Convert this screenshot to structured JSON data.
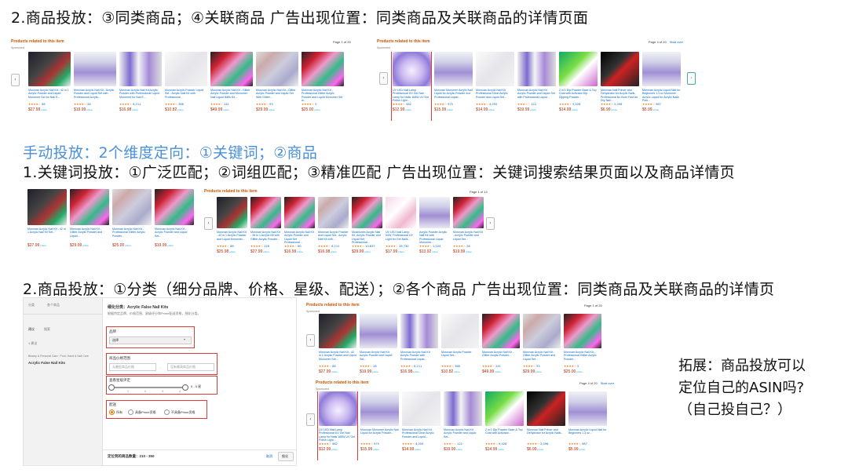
{
  "headings": {
    "h1": "2.商品投放：③同类商品；④关联商品   广告出现位置：同类商品及关联商品的详情页面",
    "h2": "手动投放：2个维度定向：①关键词；②商品",
    "h3": "1.关键词投放：①广泛匹配；②词组匹配；③精准匹配     广告出现位置：关键词搜索结果页面以及商品详情页",
    "h4": "2.商品投放：①分类（细分品牌、价格、星级、配送）；②各个商品   广告出现位置：同类商品及关联商品的详情页"
  },
  "callout": {
    "line1": "拓展：商品投放可以",
    "line2": "定位自己的ASIN吗?",
    "line3": "（自己投自己？）"
  },
  "common": {
    "carousel_title": "Products related to this item",
    "sponsored": "Sponsored",
    "page_1_of_20": "Page 1 of 20",
    "page_4_of_20": "Page 4 of 20",
    "page_1_of_14": "Page 1 of 14",
    "start_over": "Start over",
    "prev_arrow": "‹",
    "next_arrow": "›",
    "prime": "prime"
  },
  "carousel_top_left": [
    {
      "title": "Morovan Acrylic Nail Kit - 42 in 1 Acrylic Powder and Liquid Monomer Set for Nail E...",
      "stars": "★★★★☆",
      "reviews": "86",
      "price": "$27.99",
      "theme": "t-dark"
    },
    {
      "title": "Morovan Acrylic Nail Kit - Acrylic Powder and Liquid Set with Professional Acrylic...",
      "stars": "★★★★☆",
      "reviews": "28",
      "price": "$19.99",
      "theme": "t-purple"
    },
    {
      "title": "Morovan Acrylic Nail Kit Acrylic Powder with Professional Liquid Monomer for Nail E...",
      "stars": "★★★★☆",
      "reviews": "6,211",
      "price": "$16.98",
      "theme": "t-bottles"
    },
    {
      "title": "Morovan Acrylic Powder Liquid Set - Acrylic Nail Kit with Professional...",
      "stars": "★★★★☆",
      "reviews": "368",
      "price": "$10.82",
      "theme": "t-white"
    },
    {
      "title": "Morovan Acrylic Nail Kit - Glitter Acrylic Powder and Monomer Nail Liquid Nails Kit...",
      "stars": "★★★★☆",
      "reviews": "241",
      "price": "$49.99",
      "theme": "t-kit"
    },
    {
      "title": "Morovan Acrylic Nail Kit - Glitter Acrylic Powder and Liquid Set With Glitter...",
      "stars": "★★★★☆",
      "reviews": "93",
      "price": "$29.99",
      "theme": "t-glitter"
    },
    {
      "title": "Morovan Acrylic Nail Kit - Professional Glitter Acrylic Powder and Liquid Monomer Set w...",
      "stars": "★★★★☆",
      "reviews": "5",
      "price": "$25.00",
      "theme": "t-kit"
    }
  ],
  "carousel_top_right": [
    {
      "title": "UV LED Nail Lamp Professional UV Gel Nail Lamp for Nails 168W UV Gel Polish Light...",
      "stars": "★★★★☆",
      "reviews": "482",
      "price": "$12.99",
      "theme": "t-lamp",
      "boxed": true
    },
    {
      "title": "Morovan Monomer Acrylic Nail Liquid for Acrylic Powder 4oz Professional Liquid...",
      "stars": "★★★★☆",
      "reviews": "975",
      "price": "$15.99",
      "theme": "t-purple"
    },
    {
      "title": "Morovan Acrylic Nail Kit Professional Clear Acrylic Powder and Liquid Set...",
      "stars": "★★★★☆",
      "reviews": "4,055",
      "price": "$14.99",
      "theme": "t-white"
    },
    {
      "title": "Morovan Acrylic Nail Kit Acrylic Powder and Liquid Set with Professional Liquid...",
      "stars": "★★★☆☆",
      "reviews": "122",
      "price": "$19.99",
      "theme": "t-bottles"
    },
    {
      "title": "2 in 1 Dip Powder Base & Top Coat with Activator Dip Dipping Powder...",
      "stars": "★★★★☆",
      "reviews": "9,026",
      "price": "$14.99",
      "theme": "t-green"
    },
    {
      "title": "Morovan Nail Primer and Dehydrator for Acrylic Nails, Professional No Burn Fast Air Dry Nail...",
      "stars": "★★★★☆",
      "reviews": "2,096",
      "price": "$6.99",
      "theme": "t-black"
    },
    {
      "title": "Morovan Acrylic Liquid Nail for Beginners 1.3 oz Monomer Acrylic Liquid for Acrylic Nails Pow...",
      "stars": "★★★★☆",
      "reviews": "987",
      "price": "$5.99",
      "theme": "t-purple"
    }
  ],
  "search_results": [
    {
      "title": "Morovan Acrylic Nail Kit - 42 in 1 Acrylic Nail Kit Set...",
      "price": "$27.99",
      "theme": "t-dark"
    },
    {
      "title": "Morovan Acrylic Nail Kit - Glitter Acrylic Powder and Liquid...",
      "price": "$29.99",
      "theme": "t-kit"
    },
    {
      "title": "Morovan Acrylic Nail Kit - Professional Glitter Acrylic Powder...",
      "price": "$25.00",
      "theme": "t-glitter"
    },
    {
      "title": "Morovan Acrylic Nail Kit - Acrylic Powder and Liquid Set...",
      "price": "$19.99",
      "theme": "t-kit"
    }
  ],
  "carousel_mid": [
    {
      "title": "Morovan Acrylic Nail Kit - 42 in 1 Acrylic Powder and Liquid Monomer...",
      "stars": "★★★★☆",
      "reviews": "86",
      "price": "$25.98",
      "theme": "t-dark"
    },
    {
      "title": "Morovan Acrylic Nail Kit - 36 in 1 Acrylic Kit with Glitter Acrylic Powder...",
      "stars": "★★★★☆",
      "reviews": "128",
      "price": "$27.99",
      "theme": "t-kit"
    },
    {
      "title": "Morovan Acrylic Nail Kit Acrylic Powder and Liquid Set Professional...",
      "stars": "★★★★☆",
      "reviews": "60",
      "price": "$16.99",
      "theme": "t-kit"
    },
    {
      "title": "Morovan Acrylic Powder and Liquid Set - Acrylic Nail Kit with...",
      "stars": "★★★★☆",
      "reviews": "6,211",
      "price": "$16.98",
      "theme": "t-glitter"
    },
    {
      "title": "Modelones Acrylic Nail Kit, Acrylic Powder and Liquid Set, Professional...",
      "stars": "★★★★☆",
      "reviews": "10,637",
      "price": "$29.99",
      "theme": "t-kit"
    },
    {
      "title": "UV LED Nail Lamp 54W, Professional UV Light for Gel Nails...",
      "stars": "★★★★☆",
      "reviews": "26,732",
      "price": "$17.99",
      "theme": "t-tip"
    },
    {
      "title": "Acrylic Powder Acrylic Nail Kit with Professional Liquid Monomer...",
      "stars": "★★★★☆",
      "reviews": "1,024",
      "price": "$13.92",
      "theme": "t-purple"
    },
    {
      "title": "Morovan Acrylic Nail Kit - Acrylic Powder and Liquid Set...",
      "stars": "★★★★☆",
      "reviews": "28",
      "price": "$19.99",
      "theme": "t-kit"
    }
  ],
  "carousel_bot_top": [
    {
      "title": "Morovan Acrylic Nail Kit - 42 in 1 Acrylic Powder and Liquid Monomer Set...",
      "stars": "★★★★☆",
      "reviews": "86",
      "price": "$27.99",
      "theme": "t-dark"
    },
    {
      "title": "Morovan Acrylic Nail Kit Acrylic Powder and Liquid Set...",
      "stars": "★★★★☆",
      "reviews": "28",
      "price": "$19.99",
      "theme": "t-purple"
    },
    {
      "title": "Morovan Acrylic Nail Kit Acrylic Powder with Professional Liquid...",
      "stars": "★★★★☆",
      "reviews": "6,211",
      "price": "$16.98",
      "theme": "t-bottles"
    },
    {
      "title": "Morovan Acrylic Powder Liquid Set...",
      "stars": "★★★★☆",
      "reviews": "368",
      "price": "$10.82",
      "theme": "t-white"
    },
    {
      "title": "Morovan Acrylic Nail Kit - Glitter Acrylic Powder...",
      "stars": "★★★★☆",
      "reviews": "241",
      "price": "$49.99",
      "theme": "t-kit"
    },
    {
      "title": "Morovan Acrylic Nail Kit - Glitter Acrylic Powder and Liquid Set...",
      "stars": "★★★★☆",
      "reviews": "93",
      "price": "$29.99",
      "theme": "t-glitter"
    },
    {
      "title": "Morovan Acrylic Nail Kit - Professional Glitter Acrylic Powder...",
      "stars": "★★★★☆",
      "reviews": "5",
      "price": "$25.00",
      "theme": "t-kit"
    }
  ],
  "carousel_bot_bottom": [
    {
      "title": "UV LED Nail Lamp Professional UV Gel Nail Lamp for Nails 168W UV Gel Polish Light...",
      "stars": "★★★★☆",
      "reviews": "482",
      "price": "$12.99",
      "theme": "t-lamp",
      "boxed": true
    },
    {
      "title": "Morovan Monomer Acrylic Nail Liquid for Acrylic Powder...",
      "stars": "★★★★☆",
      "reviews": "975",
      "price": "$15.99",
      "theme": "t-purple"
    },
    {
      "title": "Morovan Acrylic Nail Kit Professional Clear Acrylic Powder and Liquid...",
      "stars": "★★★★☆",
      "reviews": "4,055",
      "price": "$14.99",
      "theme": "t-white"
    },
    {
      "title": "Morovan Acrylic Nail Kit Acrylic Powder and Liquid Set...",
      "stars": "★★★☆☆",
      "reviews": "122",
      "price": "$19.99",
      "theme": "t-bottles"
    },
    {
      "title": "2 in 1 Dip Powder Base & Top Coat with Activator...",
      "stars": "★★★★☆",
      "reviews": "9,026",
      "price": "$14.99",
      "theme": "t-green"
    },
    {
      "title": "Morovan Nail Primer and Dehydrator for Acrylic Nails...",
      "stars": "★★★★☆",
      "reviews": "2,096",
      "price": "$6.99",
      "theme": "t-black"
    },
    {
      "title": "Morovan Acrylic Liquid Nail for Beginners 1.3 oz...",
      "stars": "★★★★☆",
      "reviews": "987",
      "price": "$5.99",
      "theme": "t-purple"
    }
  ],
  "admin": {
    "sidebar_tab_1": "分类",
    "sidebar_tab_2": "各个商品",
    "sidebar_suggest": "建议",
    "sidebar_search": "搜索",
    "sidebar_count": "1 建议",
    "sidebar_path": "Beauty & Personal Care › Foot, Hand & Nail Care",
    "sidebar_item": "Acrylic False Nail Kits",
    "title": "细化分类：Acrylic False Nail Kits",
    "subtitle": "根据特定品牌、价格范围、星级评分和Prime配送资格，细化分类。",
    "brand_label": "品牌",
    "brand_value": "选择",
    "price_label": "商品价格范围",
    "price_min_placeholder": "无最低商品价格",
    "price_dash": "-",
    "price_max_placeholder": "没有最高商品价格",
    "rating_label": "查看星级评定",
    "rating_value": "0 - 5 星",
    "rating_ticks": [
      "1",
      "2",
      "3",
      "4"
    ],
    "delivery_label": "配送",
    "delivery_options": [
      "所有",
      "具备Prime资格",
      "不具备Prime资格"
    ],
    "summary_label": "定位到的商品数量：210 - 350",
    "cancel": "取消",
    "confirm": "细化"
  }
}
